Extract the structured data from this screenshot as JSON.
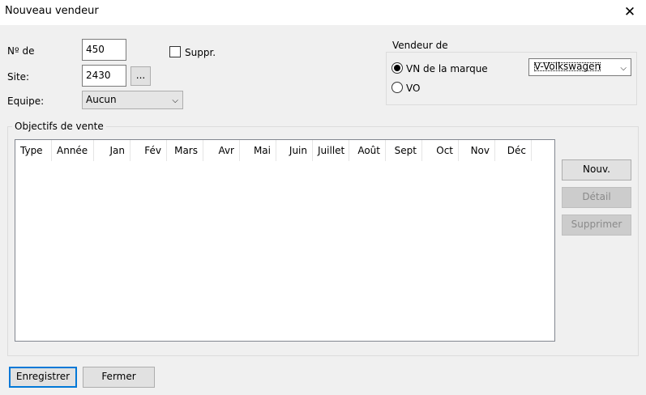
{
  "window": {
    "title": "Nouveau vendeur"
  },
  "form": {
    "num_label": "Nº de",
    "num_value": "450",
    "site_label": "Site:",
    "site_value": "2430",
    "site_browse": "...",
    "equipe_label": "Equipe:",
    "equipe_value": "Aucun",
    "suppr_label": "Suppr."
  },
  "vendeur": {
    "title": "Vendeur de",
    "vn_label": "VN de la marque",
    "vo_label": "VO",
    "brand_value": "V-Volkswagen"
  },
  "objectifs": {
    "title": "Objectifs de vente",
    "columns": [
      "Type",
      "Année",
      "Jan",
      "Fév",
      "Mars",
      "Avr",
      "Mai",
      "Juin",
      "Juillet",
      "Août",
      "Sept",
      "Oct",
      "Nov",
      "Déc"
    ]
  },
  "buttons": {
    "nouv": "Nouv.",
    "detail": "Détail",
    "supprimer": "Supprimer",
    "enregistrer": "Enregistrer",
    "fermer": "Fermer"
  },
  "icons": {
    "close": "close-icon",
    "chevron": "chevron-down-icon"
  }
}
